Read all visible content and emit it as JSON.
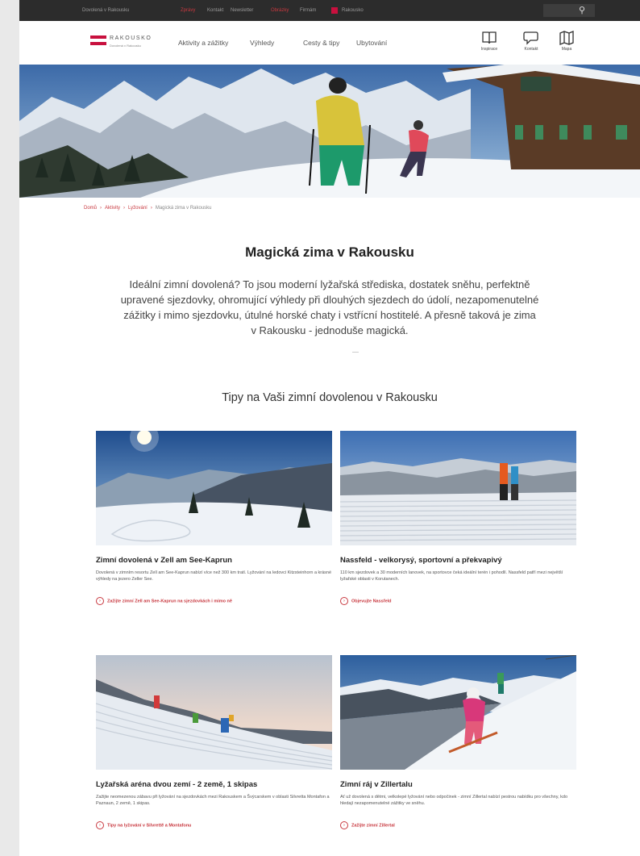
{
  "topbar": {
    "items": [
      "Dovolená v Rakousku",
      "Zprávy",
      "Kontakt",
      "Newsletter",
      "Obrázky",
      "Firmám",
      "Rakousko"
    ],
    "search_icon": "search-icon"
  },
  "header": {
    "logo_name": "RAKOUSKO",
    "logo_sub": "Dovolená v Rakousku",
    "nav": [
      "Aktivity a zážitky",
      "Výhledy",
      "Cesty & tipy",
      "Ubytování"
    ],
    "icons": [
      {
        "label": "Inspirace",
        "icon": "book-icon"
      },
      {
        "label": "Kontakt",
        "icon": "chat-icon"
      },
      {
        "label": "Mapa",
        "icon": "map-icon"
      }
    ]
  },
  "breadcrumb": [
    "Domů",
    "Aktivity",
    "Lyžování"
  ],
  "breadcrumb_current": "Magická zima v Rakousku",
  "main": {
    "title": "Magická zima v Rakousku",
    "intro": "Ideální zimní dovolená? To jsou moderní lyžařská střediska, dostatek sněhu, perfektně upravené sjezdovky, ohromující výhledy při dlouhých sjezdech do údolí, nezapomenutelné zážitky i mimo sjezdovku, útulné horské chaty i vstřícní hostitelé. A přesně taková je zima v Rakousku - jednoduše magická.",
    "subtitle": "Tipy na Vaši zimní dovolenou v Rakousku"
  },
  "cards": [
    {
      "title": "Zimní dovolená v Zell am See-Kaprun",
      "desc": "Dovolená v zimním resortu Zell am See-Kaprun nabízí více než 300 km tratí. Lyžování na ledovci Kitzsteinhorn a krásné výhledy na jezero Zeller See.",
      "link": "Zažijte zimní Zell am See-Kaprun na sjezdovkách i mimo ně"
    },
    {
      "title": "Nassfeld - velkorysý, sportovní a překvapivý",
      "desc": "110 km sjezdovek a 30 moderních lanovek, na sportovce čeká ideální terén i pohodlí. Nassfeld patří mezi největší lyžařské oblasti v Korutanech.",
      "link": "Objevujte Nassfeld"
    },
    {
      "title": "Lyžařská aréna dvou zemí - 2 země, 1 skipas",
      "desc": "Zažijte neomezenou zábavu při lyžování na sjezdovkách mezi Rakouskem a Švýcarskem v oblasti Silvretta Montafon a Paznaun, 2 země, 1 skipas.",
      "link": "Tipy na lyžování v Silvrettě a Montafonu"
    },
    {
      "title": "Zimní ráj v Zillertalu",
      "desc": "Ať už dovolená s dětmi, velkolepé lyžování nebo odpočinek - zimní Zillertal nabízí pestrou nabídku pro všechny, kdo hledají nezapomenutelné zážitky ve sněhu.",
      "link": "Zažijte zimní Zillertal"
    }
  ],
  "colors": {
    "accent": "#c8383f",
    "topbar": "#2c2c2c",
    "brand_red": "#c8103e"
  }
}
